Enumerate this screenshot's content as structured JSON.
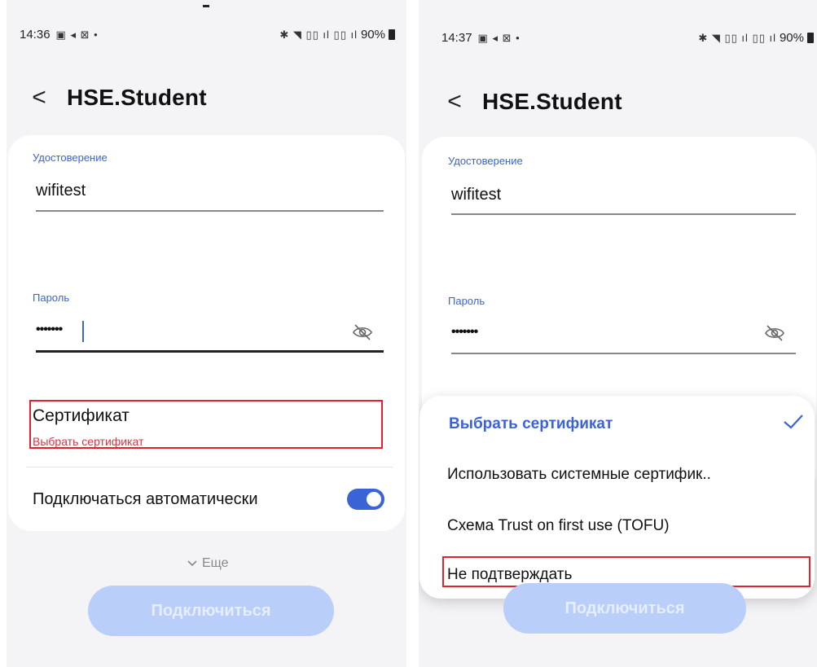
{
  "left": {
    "status": {
      "time": "14:36",
      "left_icons": "▣ ◂ ⊠ •",
      "right_icons": "✱ ◥ ▯▯ ıl ▯▯ ıl",
      "battery": "90%"
    },
    "header": {
      "title": "HSE.Student"
    },
    "identity": {
      "label": "Удостоверение",
      "value": "wifitest"
    },
    "password": {
      "label": "Пароль",
      "value": "•••••••"
    },
    "certificate": {
      "label": "Сертификат",
      "value": "Выбрать сертификат"
    },
    "auto_connect": {
      "label": "Подключаться автоматически",
      "enabled": true
    },
    "more": {
      "label": "Еще"
    },
    "connect_button": {
      "label": "Подключиться"
    }
  },
  "right": {
    "status": {
      "time": "14:37",
      "left_icons": "▣ ◂ ⊠ •",
      "right_icons": "✱ ◥ ▯▯ ıl ▯▯ ıl",
      "battery": "90%"
    },
    "header": {
      "title": "HSE.Student"
    },
    "identity": {
      "label": "Удостоверение",
      "value": "wifitest"
    },
    "password": {
      "label": "Пароль",
      "value": "•••••••"
    },
    "certificate_options": [
      {
        "label": "Выбрать сертификат",
        "selected": true
      },
      {
        "label": "Использовать системные сертифик..",
        "selected": false
      },
      {
        "label": "Схема Trust on first use (TOFU)",
        "selected": false
      },
      {
        "label": "Не подтверждать",
        "selected": false
      }
    ],
    "connect_button": {
      "label": "Подключиться"
    }
  },
  "colors": {
    "accent": "#3a63d6",
    "error": "#d9363e",
    "highlight_box": "#e0232f",
    "disabled_button": "#b9cef8"
  }
}
